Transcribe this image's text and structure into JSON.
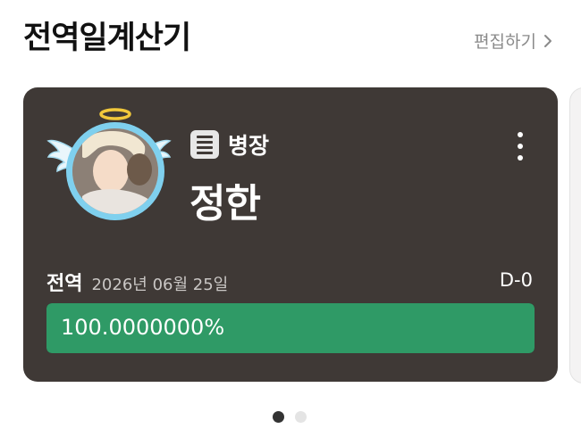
{
  "header": {
    "title": "전역일계산기",
    "edit_label": "편집하기"
  },
  "card": {
    "rank": "병장",
    "name": "정한",
    "discharge_label": "전역",
    "discharge_date": "2026년 06월 25일",
    "dday": "D-0",
    "progress_text": "100.0000000%",
    "progress_fraction": 1.0
  },
  "pager": {
    "total": 2,
    "active": 0
  },
  "colors": {
    "card_bg": "#3f3936",
    "progress_fill": "#2f9a66",
    "halo": "#f2c93b",
    "avatar_ring": "#7fd0ee"
  },
  "icons": [
    "chevron-right-icon",
    "list-icon",
    "more-vertical-icon",
    "halo-icon",
    "wing-icon"
  ]
}
